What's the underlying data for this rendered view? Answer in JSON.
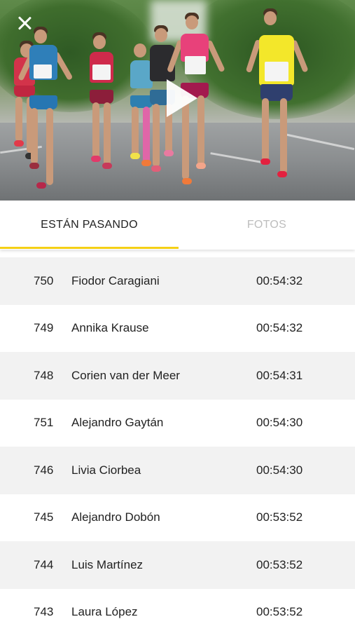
{
  "colors": {
    "accent": "#f5d016",
    "text_primary": "#222222",
    "text_inactive": "#bdbdbd",
    "row_alt_bg": "#f2f2f2"
  },
  "hero": {
    "close_icon": "close-icon",
    "play_icon": "play-icon"
  },
  "tabs": [
    {
      "label": "ESTÁN PASANDO",
      "active": true
    },
    {
      "label": "FOTOS",
      "active": false
    }
  ],
  "runners": [
    {
      "number": "750",
      "name": "Fiodor Caragiani",
      "time": "00:54:32"
    },
    {
      "number": "749",
      "name": "Annika Krause",
      "time": "00:54:32"
    },
    {
      "number": "748",
      "name": "Corien van der Meer",
      "time": "00:54:31"
    },
    {
      "number": "751",
      "name": "Alejandro Gaytán",
      "time": "00:54:30"
    },
    {
      "number": "746",
      "name": "Livia Ciorbea",
      "time": "00:54:30"
    },
    {
      "number": "745",
      "name": "Alejandro Dobón",
      "time": "00:53:52"
    },
    {
      "number": "744",
      "name": "Luis Martínez",
      "time": "00:53:52"
    },
    {
      "number": "743",
      "name": "Laura López",
      "time": "00:53:52"
    }
  ]
}
